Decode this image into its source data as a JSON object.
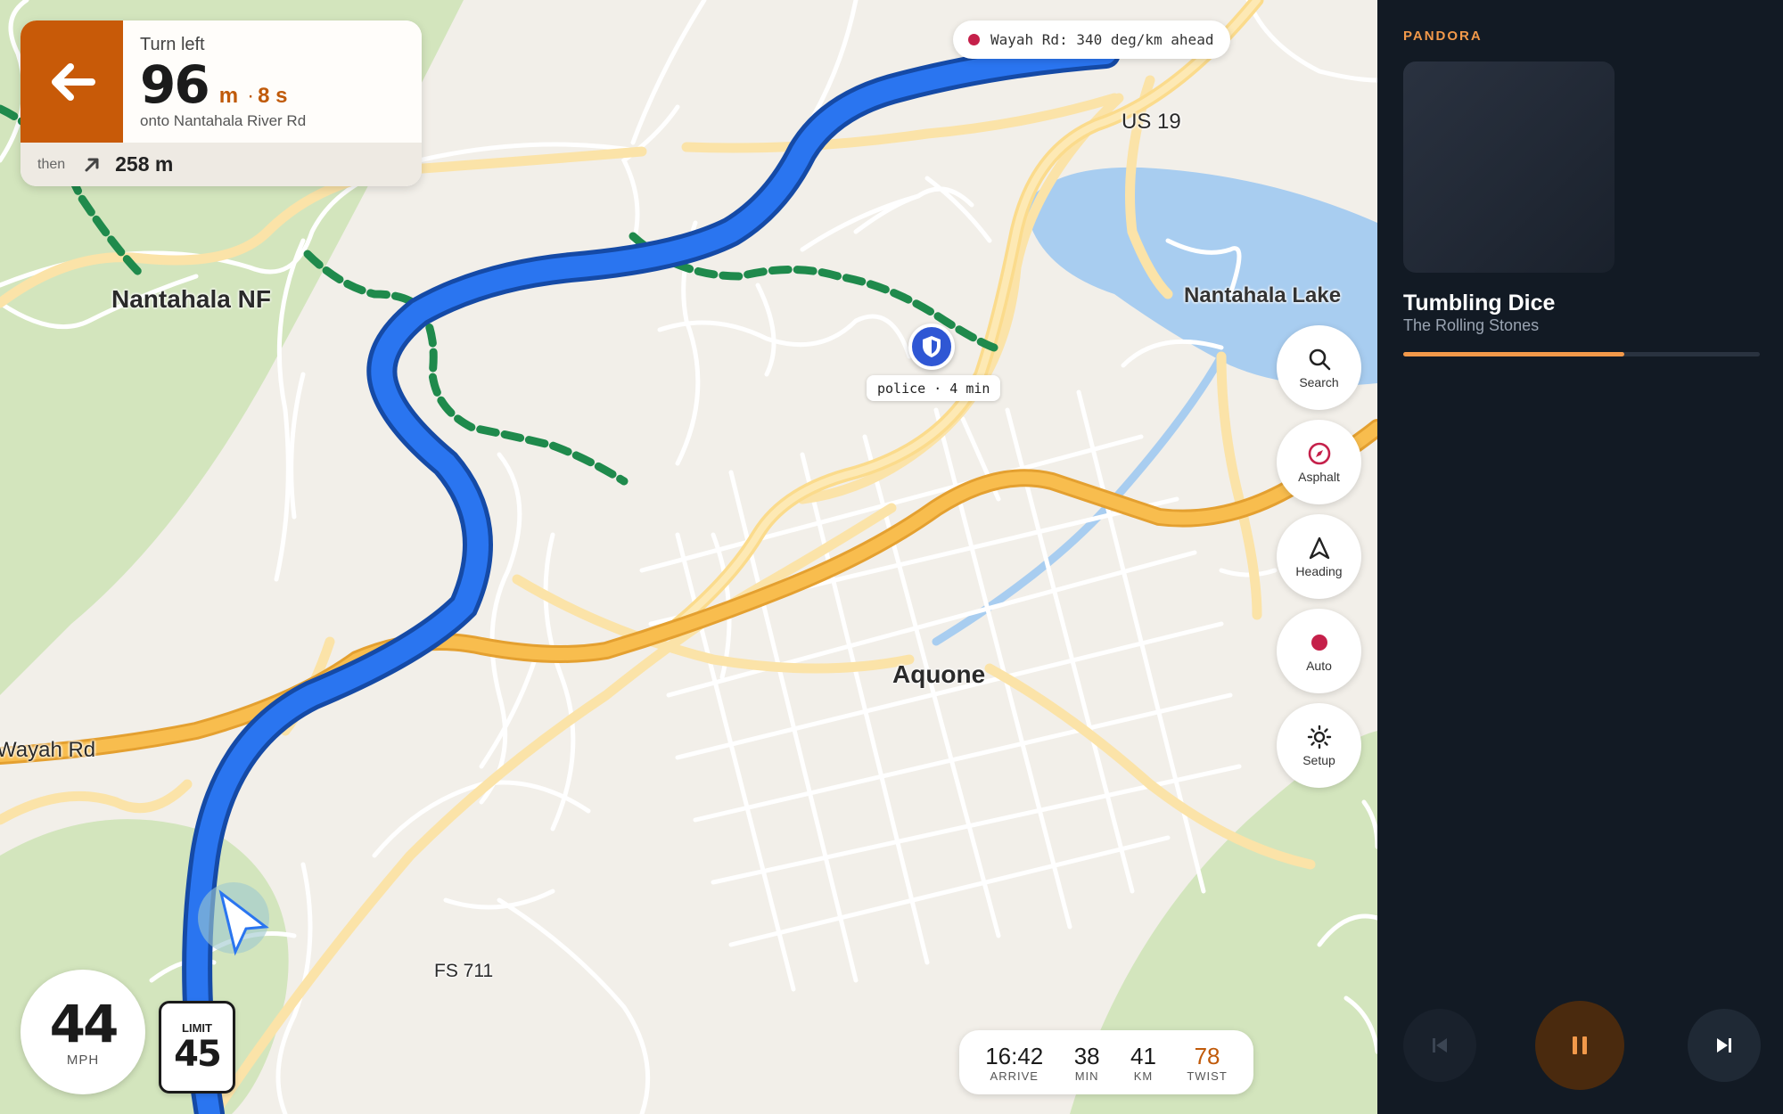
{
  "map": {
    "labels": {
      "nantahala_nf": "Nantahala NF",
      "us19": "US 19",
      "nantahala_lake": "Nantahala Lake",
      "aquone": "Aquone",
      "wayah_rd": "Wayah Rd",
      "fs711": "FS 711"
    }
  },
  "turn": {
    "action": "Turn left",
    "distance": "96",
    "unit": "m",
    "separator": "·",
    "time": "8 s",
    "street": "onto Nantahala River Rd",
    "then_label": "then",
    "then_distance": "258 m",
    "arrow_icon": "arrow-left-icon",
    "then_icon": "arrow-up-right-icon"
  },
  "hazard": {
    "text": "Wayah Rd: 340 deg/km ahead",
    "dot_color": "#c5204a"
  },
  "police": {
    "label": "police · 4 min",
    "icon": "shield-icon"
  },
  "buttons": [
    {
      "label": "Search",
      "icon": "search-icon"
    },
    {
      "label": "Asphalt",
      "icon": "compass-icon"
    },
    {
      "label": "Heading",
      "icon": "heading-arrow-icon"
    },
    {
      "label": "Auto",
      "icon": "record-dot-icon"
    },
    {
      "label": "Setup",
      "icon": "gear-icon"
    }
  ],
  "speed": {
    "value": "44",
    "unit": "MPH",
    "limit_label": "LIMIT",
    "limit_value": "45"
  },
  "trip": {
    "arrive_value": "16:42",
    "arrive_label": "ARRIVE",
    "min_value": "38",
    "min_label": "MIN",
    "km_value": "41",
    "km_label": "KM",
    "twist_value": "78",
    "twist_label": "TWIST"
  },
  "media": {
    "source": "PANDORA",
    "title": "Tumbling Dice",
    "artist": "The Rolling Stones",
    "progress": 0.62,
    "accent": "#f2994a"
  },
  "colors": {
    "route": "#2a75f0",
    "highway": "#f7b84a",
    "trail": "#1f8a4c",
    "water": "#a8cdf0",
    "forest": "#cfe3b8"
  }
}
